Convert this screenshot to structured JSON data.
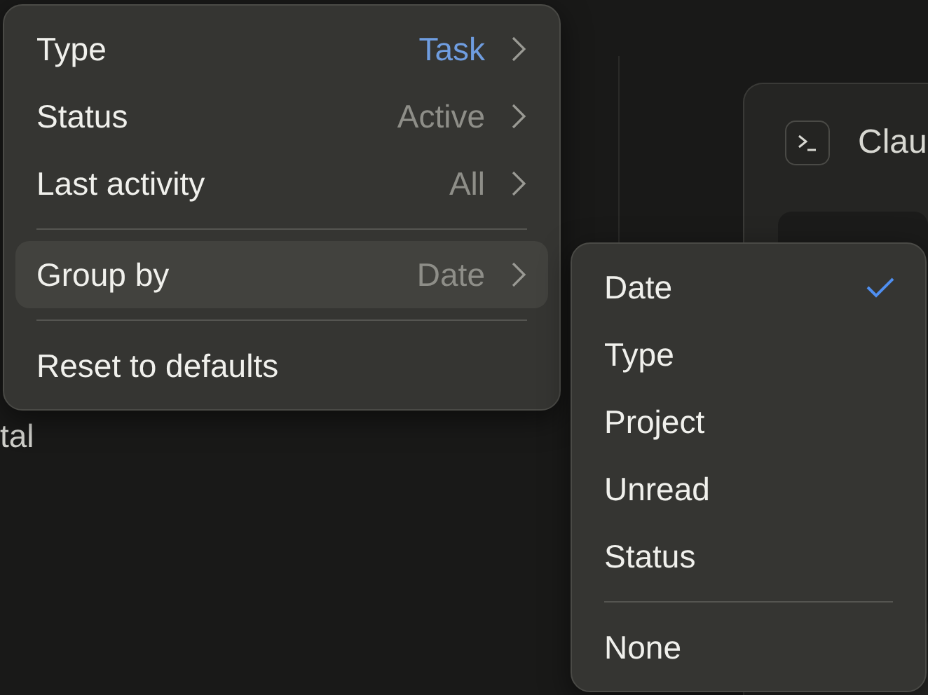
{
  "background": {
    "left_text": "tal",
    "card": {
      "title": "Clau"
    }
  },
  "menu": {
    "items": [
      {
        "kind": "option",
        "label": "Type",
        "value": "Task",
        "accent": true,
        "selected": false
      },
      {
        "kind": "option",
        "label": "Status",
        "value": "Active",
        "accent": false,
        "selected": false
      },
      {
        "kind": "option",
        "label": "Last activity",
        "value": "All",
        "accent": false,
        "selected": false
      },
      {
        "kind": "divider"
      },
      {
        "kind": "option",
        "label": "Group by",
        "value": "Date",
        "accent": false,
        "selected": true
      },
      {
        "kind": "divider"
      },
      {
        "kind": "action",
        "label": "Reset to defaults"
      }
    ]
  },
  "submenu": {
    "items": [
      {
        "kind": "option",
        "label": "Date",
        "checked": true
      },
      {
        "kind": "option",
        "label": "Type",
        "checked": false
      },
      {
        "kind": "option",
        "label": "Project",
        "checked": false
      },
      {
        "kind": "option",
        "label": "Unread",
        "checked": false
      },
      {
        "kind": "option",
        "label": "Status",
        "checked": false
      },
      {
        "kind": "divider"
      },
      {
        "kind": "option",
        "label": "None",
        "checked": false
      }
    ]
  }
}
